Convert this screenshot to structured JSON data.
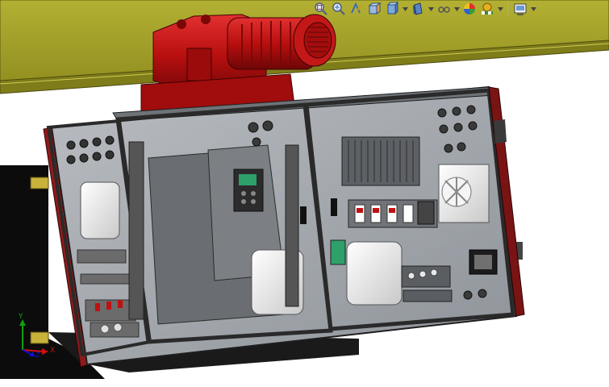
{
  "viewport": {
    "background": "#ffffff",
    "model_colors": {
      "beam": "#a9a629",
      "motor": "#b50d0d",
      "cabinet_frame": "#3a3a3a",
      "cabinet_glass": "#9aa0a6",
      "panel_accent": "#8f1a1a"
    }
  },
  "heads_up_toolbar": {
    "tools": [
      {
        "id": "zoom-to-fit",
        "icon": "zoom-to-fit-icon"
      },
      {
        "id": "zoom-to-area",
        "icon": "zoom-to-area-icon"
      },
      {
        "id": "previous-view",
        "icon": "previous-view-icon"
      },
      {
        "id": "section-view",
        "icon": "section-view-icon"
      },
      {
        "id": "view-orientation",
        "icon": "view-orientation-icon",
        "has_dropdown": true
      },
      {
        "id": "display-style",
        "icon": "display-style-icon",
        "has_dropdown": true
      },
      {
        "id": "hide-show-items",
        "icon": "hide-show-items-icon",
        "has_dropdown": true
      },
      {
        "id": "edit-appearance",
        "icon": "edit-appearance-icon"
      },
      {
        "id": "apply-scene",
        "icon": "apply-scene-icon",
        "has_dropdown": true
      },
      {
        "id": "view-settings",
        "icon": "view-settings-icon",
        "has_dropdown": true
      }
    ]
  },
  "triad": {
    "x_label": "X",
    "y_label": "Y",
    "z_label": "Z",
    "x_color": "#d01010",
    "y_color": "#10a010",
    "z_color": "#1010d0"
  }
}
